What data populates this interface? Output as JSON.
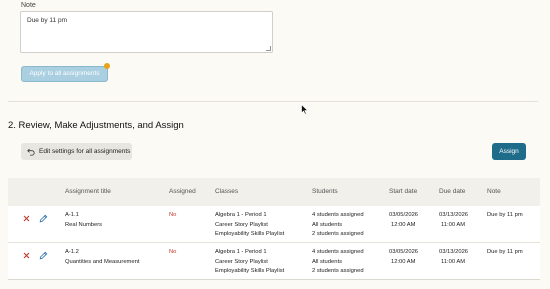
{
  "note": {
    "label": "Note",
    "value": "Due by 11 pm"
  },
  "apply_button": {
    "label": "Apply to all assignments",
    "badge_color": "#e8a318"
  },
  "section": {
    "title": "2. Review, Make Adjustments, and Assign",
    "edit_settings_label": "Edit settings for all assignments",
    "assign_label": "Assign"
  },
  "colors": {
    "accent": "#1f6c8a",
    "no_status": "#c0392b",
    "edit_icon": "#2a6fb0"
  },
  "table": {
    "headers": [
      "Assignment title",
      "Assigned",
      "Classes",
      "Students",
      "Start date",
      "Due date",
      "Note"
    ],
    "rows": [
      {
        "code": "A-1.1",
        "title": "Real Numbers",
        "assigned": "No",
        "classes": [
          "Algebra 1 - Period 1",
          "Career Story Playlist",
          "Employability Skills Playlist"
        ],
        "students": [
          "4 students assigned",
          "All students",
          "2 students assigned"
        ],
        "start_date": "03/05/2026",
        "start_time": "12:00 AM",
        "due_date": "03/13/2026",
        "due_time": "11:00 AM",
        "note": "Due by 11 pm"
      },
      {
        "code": "A-1.2",
        "title": "Quantities and Measurement",
        "assigned": "No",
        "classes": [
          "Algebra 1 - Period 1",
          "Career Story Playlist",
          "Employability Skills Playlist"
        ],
        "students": [
          "4 students assigned",
          "All students",
          "2 students assigned"
        ],
        "start_date": "03/05/2026",
        "start_time": "12:00 AM",
        "due_date": "03/13/2026",
        "due_time": "11:00 AM",
        "note": "Due by 11 pm"
      }
    ]
  }
}
